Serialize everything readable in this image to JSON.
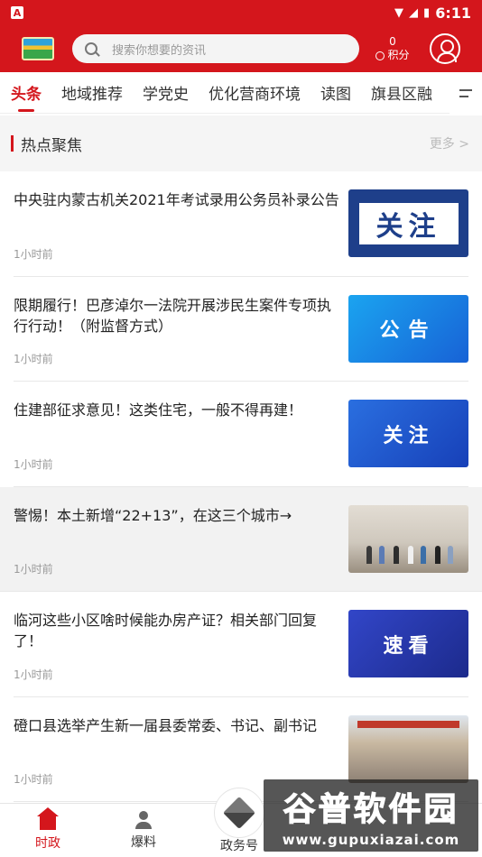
{
  "status_bar": {
    "time": "6:11",
    "left_icon": "A"
  },
  "header": {
    "search_placeholder": "搜索你想要的资讯",
    "points_value": "0",
    "points_label": "积分"
  },
  "tabs": [
    "头条",
    "地域推荐",
    "学党史",
    "优化营商环境",
    "读图",
    "旗县区融"
  ],
  "section": {
    "title": "热点聚焦",
    "more": "更多 >"
  },
  "news": [
    {
      "title": "中央驻内蒙古机关2021年考试录用公务员补录公告",
      "time": "1小时前",
      "thumb_text": "关注"
    },
    {
      "title": "限期履行！巴彦淖尔一法院开展涉民生案件专项执行行动！（附监督方式）",
      "time": "1小时前",
      "thumb_text": "公告"
    },
    {
      "title": "住建部征求意见！这类住宅，一般不得再建！",
      "time": "1小时前",
      "thumb_text": "关注"
    },
    {
      "title": "警惕！本土新增“22+13”，在这三个城市→",
      "time": "1小时前",
      "thumb_text": ""
    },
    {
      "title": "临河这些小区啥时候能办房产证？相关部门回复了！",
      "time": "1小时前",
      "thumb_text": "速看"
    },
    {
      "title": "磴口县选举产生新一届县委常委、书记、副书记",
      "time": "1小时前",
      "thumb_text": ""
    }
  ],
  "bottom_nav": {
    "home": "时政",
    "report": "爆料",
    "gov": "政务号"
  },
  "watermark": {
    "title": "谷普软件园",
    "url": "www.gupuxiazai.com"
  },
  "colors": {
    "brand_red": "#d4161c"
  }
}
